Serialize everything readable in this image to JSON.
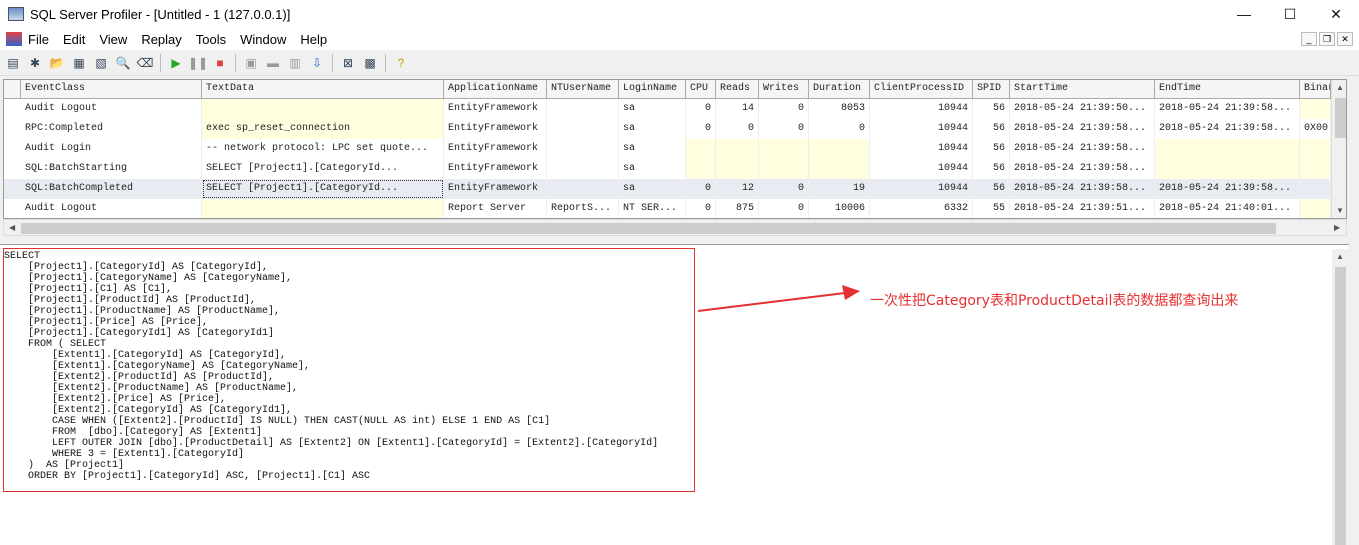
{
  "window": {
    "title": "SQL Server Profiler - [Untitled - 1 (127.0.0.1)]",
    "controls": [
      "—",
      "☐",
      "✕"
    ]
  },
  "menu": [
    "File",
    "Edit",
    "View",
    "Replay",
    "Tools",
    "Window",
    "Help"
  ],
  "mdi_controls": [
    "_",
    "❐",
    "✕"
  ],
  "toolbar": [
    {
      "icon": "properties-icon",
      "g": "▤"
    },
    {
      "icon": "new-trace-icon",
      "g": "✱"
    },
    {
      "icon": "open-icon",
      "g": "📂"
    },
    {
      "icon": "save-icon",
      "g": "▦"
    },
    {
      "icon": "template-icon",
      "g": "▧"
    },
    {
      "icon": "find-icon",
      "g": "🔍"
    },
    {
      "icon": "clear-icon",
      "g": "⌫"
    },
    {
      "sep": true
    },
    {
      "icon": "run-icon",
      "g": "▶",
      "c": "#2a2"
    },
    {
      "icon": "pause-icon",
      "g": "❚❚",
      "c": "#999"
    },
    {
      "icon": "stop-icon",
      "g": "■",
      "c": "#d44"
    },
    {
      "sep": true
    },
    {
      "icon": "properties-grey-icon",
      "g": "▣",
      "c": "#999"
    },
    {
      "icon": "filter-icon",
      "g": "▬",
      "c": "#999"
    },
    {
      "icon": "columns-icon",
      "g": "▥",
      "c": "#999"
    },
    {
      "icon": "autoscroll-icon",
      "g": "⇩",
      "c": "#36c"
    },
    {
      "sep": true
    },
    {
      "icon": "tuning-icon",
      "g": "⊠"
    },
    {
      "icon": "perfmon-icon",
      "g": "▩"
    },
    {
      "sep": true
    },
    {
      "icon": "help-icon",
      "g": "?",
      "c": "#c90"
    }
  ],
  "grid": {
    "columns": [
      "EventClass",
      "TextData",
      "ApplicationName",
      "NTUserName",
      "LoginName",
      "CPU",
      "Reads",
      "Writes",
      "Duration",
      "ClientProcessID",
      "SPID",
      "StartTime",
      "EndTime",
      "Binar"
    ],
    "rows": [
      [
        "Audit Logout",
        "",
        "EntityFramework",
        "",
        "sa",
        "0",
        "14",
        "0",
        "8053",
        "10944",
        "56",
        "2018-05-24 21:39:50...",
        "2018-05-24 21:39:58...",
        ""
      ],
      [
        "RPC:Completed",
        "exec sp_reset_connection",
        "EntityFramework",
        "",
        "sa",
        "0",
        "0",
        "0",
        "0",
        "10944",
        "56",
        "2018-05-24 21:39:58...",
        "2018-05-24 21:39:58...",
        "0X00"
      ],
      [
        "Audit Login",
        "-- network protocol: LPC  set quote...",
        "EntityFramework",
        "",
        "sa",
        "",
        "",
        "",
        "",
        "10944",
        "56",
        "2018-05-24 21:39:58...",
        "",
        ""
      ],
      [
        "SQL:BatchStarting",
        "SELECT       [Project1].[CategoryId...",
        "EntityFramework",
        "",
        "sa",
        "",
        "",
        "",
        "",
        "10944",
        "56",
        "2018-05-24 21:39:58...",
        "",
        ""
      ],
      [
        "SQL:BatchCompleted",
        "SELECT       [Project1].[CategoryId...",
        "EntityFramework",
        "",
        "sa",
        "0",
        "12",
        "0",
        "19",
        "10944",
        "56",
        "2018-05-24 21:39:58...",
        "2018-05-24 21:39:58...",
        ""
      ],
      [
        "Audit Logout",
        "",
        "Report Server",
        "ReportS...",
        "NT SER...",
        "0",
        "875",
        "0",
        "10006",
        "6332",
        "55",
        "2018-05-24 21:39:51...",
        "2018-05-24 21:40:01...",
        ""
      ]
    ],
    "selected_row": 4
  },
  "textdata_lines": [
    "SELECT",
    "    [Project1].[CategoryId] AS [CategoryId],",
    "    [Project1].[CategoryName] AS [CategoryName],",
    "    [Project1].[C1] AS [C1],",
    "    [Project1].[ProductId] AS [ProductId],",
    "    [Project1].[ProductName] AS [ProductName],",
    "    [Project1].[Price] AS [Price],",
    "    [Project1].[CategoryId1] AS [CategoryId1]",
    "    FROM ( SELECT",
    "        [Extent1].[CategoryId] AS [CategoryId],",
    "        [Extent1].[CategoryName] AS [CategoryName],",
    "        [Extent2].[ProductId] AS [ProductId],",
    "        [Extent2].[ProductName] AS [ProductName],",
    "        [Extent2].[Price] AS [Price],",
    "        [Extent2].[CategoryId] AS [CategoryId1],",
    "        CASE WHEN ([Extent2].[ProductId] IS NULL) THEN CAST(NULL AS int) ELSE 1 END AS [C1]",
    "        FROM  [dbo].[Category] AS [Extent1]",
    "        LEFT OUTER JOIN [dbo].[ProductDetail] AS [Extent2] ON [Extent1].[CategoryId] = [Extent2].[CategoryId]",
    "        WHERE 3 = [Extent1].[CategoryId]",
    "    )  AS [Project1]",
    "    ORDER BY [Project1].[CategoryId] ASC, [Project1].[C1] ASC"
  ],
  "annotation": {
    "text": "一次性把Category表和ProductDetail表的数据都查询出来",
    "color": "#e53030"
  }
}
